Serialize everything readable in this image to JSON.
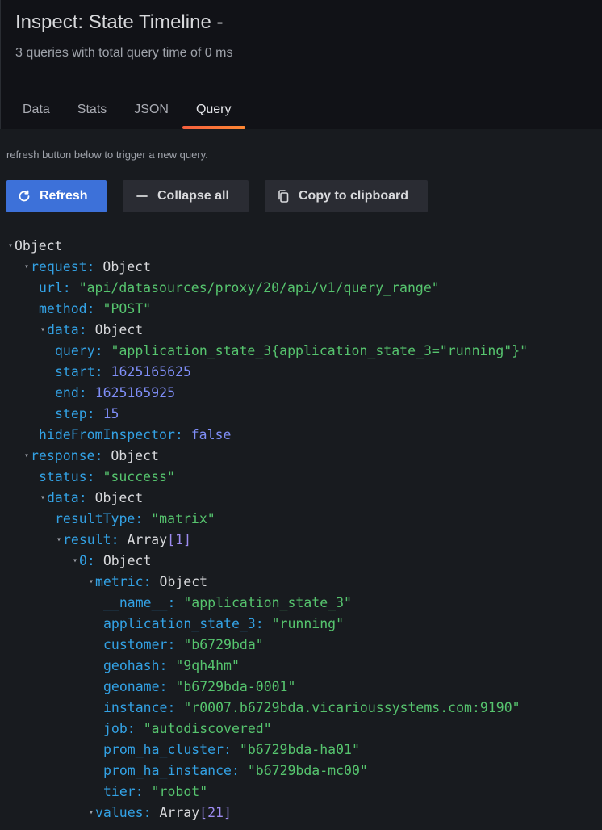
{
  "header": {
    "title": "Inspect: State Timeline -",
    "subtitle": "3 queries with total query time of 0 ms"
  },
  "tabs": [
    {
      "label": "Data",
      "active": false
    },
    {
      "label": "Stats",
      "active": false
    },
    {
      "label": "JSON",
      "active": false
    },
    {
      "label": "Query",
      "active": true
    }
  ],
  "notice": "refresh button below to trigger a new query.",
  "toolbar": {
    "refresh_label": "Refresh",
    "collapse_label": "Collapse all",
    "copy_label": "Copy to clipboard"
  },
  "colors": {
    "primary": "#3d71d9",
    "key": "#33a2e5",
    "string": "#56c46e",
    "number": "#7f8ef7",
    "tab_underline": "#f55f3e"
  },
  "tree": {
    "root": "Object",
    "request": {
      "key": "request:",
      "type": "Object",
      "url_key": "url:",
      "url": "\"api/datasources/proxy/20/api/v1/query_range\"",
      "method_key": "method:",
      "method": "\"POST\"",
      "data_key": "data:",
      "data_type": "Object",
      "query_key": "query:",
      "query": "\"application_state_3{application_state_3=\"running\"}\"",
      "start_key": "start:",
      "start": "1625165625",
      "end_key": "end:",
      "end": "1625165925",
      "step_key": "step:",
      "step": "15",
      "hide_key": "hideFromInspector:",
      "hide": "false"
    },
    "response": {
      "key": "response:",
      "type": "Object",
      "status_key": "status:",
      "status": "\"success\"",
      "data_key": "data:",
      "data_type": "Object",
      "resultType_key": "resultType:",
      "resultType": "\"matrix\"",
      "result_key": "result:",
      "result_type": "Array",
      "result_len": "[1]",
      "item0_key": "0:",
      "item0_type": "Object",
      "metric_key": "metric:",
      "metric_type": "Object",
      "metric": [
        {
          "key": "__name__:",
          "value": "\"application_state_3\""
        },
        {
          "key": "application_state_3:",
          "value": "\"running\""
        },
        {
          "key": "customer:",
          "value": "\"b6729bda\""
        },
        {
          "key": "geohash:",
          "value": "\"9qh4hm\""
        },
        {
          "key": "geoname:",
          "value": "\"b6729bda-0001\""
        },
        {
          "key": "instance:",
          "value": "\"r0007.b6729bda.vicarioussystems.com:9190\""
        },
        {
          "key": "job:",
          "value": "\"autodiscovered\""
        },
        {
          "key": "prom_ha_cluster:",
          "value": "\"b6729bda-ha01\""
        },
        {
          "key": "prom_ha_instance:",
          "value": "\"b6729bda-mc00\""
        },
        {
          "key": "tier:",
          "value": "\"robot\""
        }
      ],
      "values_key": "values:",
      "values_type": "Array",
      "values_len": "[21]"
    }
  }
}
